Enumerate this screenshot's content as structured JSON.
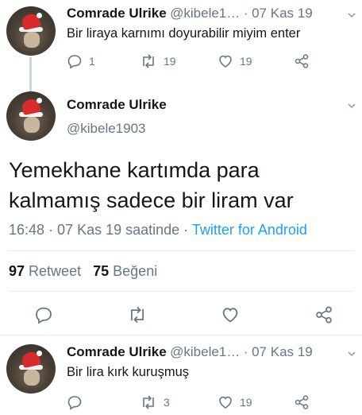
{
  "tweets": [
    {
      "name": "Comrade Ulrike",
      "handle": "@kibele1…",
      "date": "· 07 Kas 19",
      "text": "Bir liraya karnımı doyurabilir miyim enter",
      "replies": "1",
      "retweets": "19",
      "likes": "19"
    },
    {
      "name": "Comrade Ulrike",
      "handle": "@kibele1903",
      "text_line1": "Yemekhane kartımda para",
      "text_line2": "kalmamış sadece bir liram var",
      "time": "16:48 · 07 Kas 19 saatinde · ",
      "app": "Twitter for Android",
      "retweets_count": "97",
      "retweets_label": "Retweet",
      "likes_count": "75",
      "likes_label": "Beğeni"
    },
    {
      "name": "Comrade Ulrike",
      "handle": "@kibele1…",
      "date": "· 07 Kas 19",
      "text": "Bir lira kırk kuruşmuş",
      "retweets": "3",
      "likes": "19"
    }
  ],
  "icons": {
    "reply": "reply-icon",
    "retweet": "retweet-icon",
    "like": "heart-icon",
    "share": "share-icon",
    "more": "chevron-down-icon"
  },
  "colors": {
    "muted": "#657786",
    "link": "#1da1f2",
    "divider": "#e6ecf0"
  }
}
